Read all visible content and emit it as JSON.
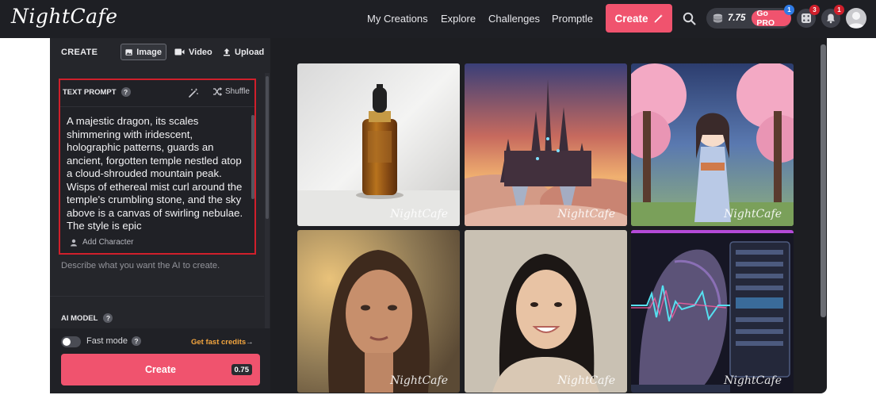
{
  "header": {
    "logo": "NightCafe",
    "nav": [
      "My Creations",
      "Explore",
      "Challenges",
      "Promptle"
    ],
    "create_label": "Create",
    "credits_value": "7.75",
    "go_pro_label": "Go PRO",
    "go_pro_badge": "1",
    "dice_badge": "3",
    "bell_badge": "1"
  },
  "panel": {
    "create_label": "CREATE",
    "tabs": [
      {
        "label": "Image",
        "icon": "image-icon",
        "active": true
      },
      {
        "label": "Video",
        "icon": "video-icon",
        "active": false
      },
      {
        "label": "Upload",
        "icon": "upload-icon",
        "active": false
      }
    ],
    "prompt": {
      "label": "TEXT PROMPT",
      "help": "?",
      "shuffle_label": "Shuffle",
      "text": "A majestic dragon, its scales shimmering with iridescent, holographic patterns, guards an ancient, forgotten temple nestled atop a cloud-shrouded mountain peak. Wisps of ethereal mist curl around the temple's crumbling stone, and the sky above is a canvas of swirling nebulae. The style is epic",
      "add_character": "Add Character"
    },
    "helper_text": "Describe what you want the AI to create.",
    "ai_model_label": "AI MODEL",
    "ai_model_help": "?",
    "fast_mode_label": "Fast mode",
    "fast_mode_help": "?",
    "fast_mode_on": false,
    "fast_credits_label": "Get fast credits",
    "create_button_label": "Create",
    "create_cost": "0.75"
  },
  "gallery": {
    "watermark": "NightCafe",
    "items": [
      {
        "subject": "serum bottle product shot"
      },
      {
        "subject": "castle at sunset above clouds"
      },
      {
        "subject": "anime girl under cherry blossoms"
      },
      {
        "subject": "portrait woman golden hour"
      },
      {
        "subject": "portrait smiling woman"
      },
      {
        "subject": "futuristic face with holographic UI"
      }
    ]
  },
  "colors": {
    "accent": "#f0536e",
    "highlight": "#d01f2b",
    "topbar": "#1e1f24",
    "panel": "#25262b",
    "fast_credits": "#f4a63f"
  }
}
